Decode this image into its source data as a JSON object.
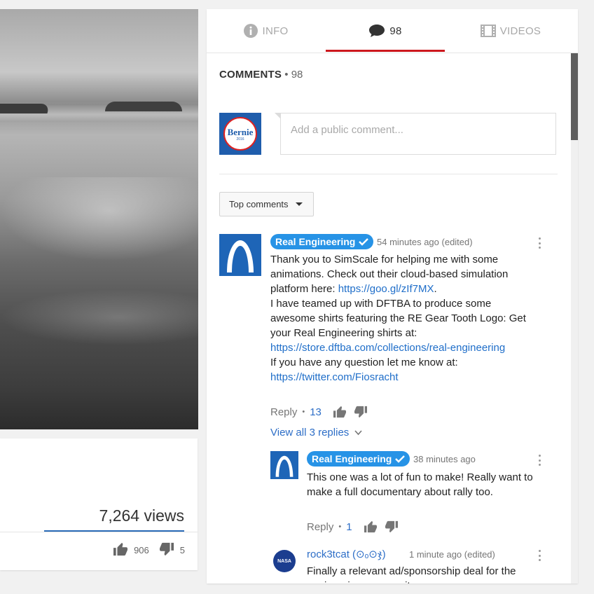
{
  "player": {
    "description": "grayscale video frame"
  },
  "info_card": {
    "views": "7,264 views",
    "likes": "906",
    "dislikes": "5"
  },
  "tabs": {
    "info": "INFO",
    "comments": "98",
    "videos": "VIDEOS"
  },
  "comments_section": {
    "title": "COMMENTS",
    "separator": "•",
    "count": "98",
    "input_placeholder": "Add a public comment...",
    "self_avatar_text": "Bernie",
    "self_avatar_subtext": "2016",
    "sort_label": "Top comments"
  },
  "comments": [
    {
      "author": "Real Engineering",
      "time": "54 minutes ago (edited)",
      "lines": [
        {
          "t": "Thank you to SimScale for helping me with some animations. Check out their cloud-based simulation platform here: "
        },
        {
          "l": "https://goo.gl/zIf7MX"
        },
        {
          "t": "."
        },
        {
          "br": true
        },
        {
          "t": "I have teamed up with DFTBA to produce some awesome shirts featuring the RE Gear Tooth Logo: Get your Real Engineering shirts at: "
        },
        {
          "l": "https://store.dftba.com/collections/real-engineering"
        },
        {
          "br": true
        },
        {
          "t": "If you have any question let me know at: "
        },
        {
          "l": "https://twitter.com/Fiosracht"
        }
      ],
      "reply_label": "Reply",
      "likes": "13",
      "view_replies": "View all 3 replies"
    },
    {
      "author": "Real Engineering",
      "time": "38 minutes ago",
      "text": "This one was a lot of fun to make! Really want to make a full documentary about rally too.",
      "reply_label": "Reply",
      "likes": "1"
    },
    {
      "author": "rock3tcat (⊙ₒ⊙ჯ)",
      "time": "1 minute ago (edited)",
      "avatar_text": "NASA",
      "text": "Finally a relevant ad/sponsorship deal for the engineering community."
    }
  ],
  "colors": {
    "accent_red": "#cc181e",
    "link_blue": "#1f6ec9",
    "badge_blue": "#2793e6"
  }
}
